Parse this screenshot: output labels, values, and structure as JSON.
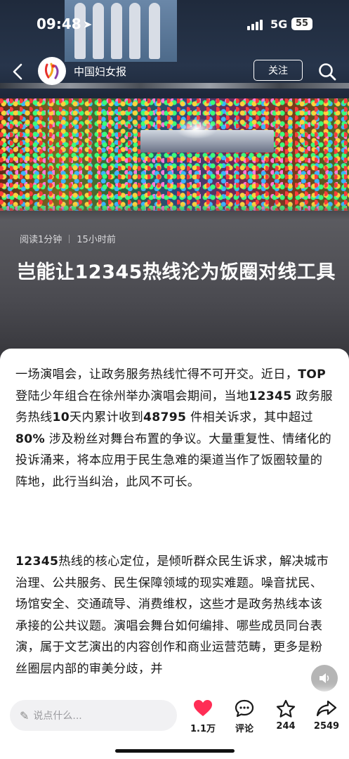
{
  "status_bar": {
    "time": "09:48",
    "network": "5G",
    "battery": "55"
  },
  "nav": {
    "publisher": "中国妇女报",
    "follow_label": "关注"
  },
  "article": {
    "read_time": "阅读1分钟",
    "published": "15小时前",
    "headline": "岂能让12345热线沦为饭圈对线工具",
    "paragraph1": [
      {
        "t": "一场演唱会，让政务服务热线忙得不可开交。近日，"
      },
      {
        "t": "TOP",
        "b": true
      },
      {
        "t": " 登陆少年组合在徐州举办演唱会期间，当地"
      },
      {
        "t": "12345",
        "b": true
      },
      {
        "t": " 政务服务热线"
      },
      {
        "t": "10",
        "b": true
      },
      {
        "t": "天内累计收到"
      },
      {
        "t": "48795",
        "b": true
      },
      {
        "t": " 件相关诉求，其中超过"
      },
      {
        "t": "80%",
        "b": true
      },
      {
        "t": " 涉及粉丝对舞台布置的争议。大量重复性、情绪化的投诉涌来，将本应用于民生急难的渠道当作了饭圈较量的阵地，此行当纠治，此风不可长。"
      }
    ],
    "paragraph2": [
      {
        "t": "12345",
        "b": true
      },
      {
        "t": "热线的核心定位，是倾听群众民生诉求，解决城市治理、公共服务、民生保障领域的现实难题。噪音扰民、场馆安全、交通疏导、消费维权，这些才是政务热线本该承接的公共议题。演唱会舞台如何编排、哪些成员同台表演，属于文艺演出的内容创作和商业运营范畴，更多是粉丝圈层内部的审美分歧，并"
      }
    ]
  },
  "bottom_bar": {
    "comment_placeholder": "说点什么...",
    "likes": "1.1万",
    "comment_label": "评论",
    "favorites": "244",
    "shares": "2549"
  },
  "colors": {
    "like_red": "#ff2d55",
    "text": "#1a1a1a"
  },
  "icons": [
    "back-icon",
    "publisher-logo-icon",
    "search-icon",
    "location-arrow-icon",
    "sound-icon",
    "pen-icon",
    "heart-icon",
    "comment-icon",
    "star-icon",
    "share-icon"
  ]
}
